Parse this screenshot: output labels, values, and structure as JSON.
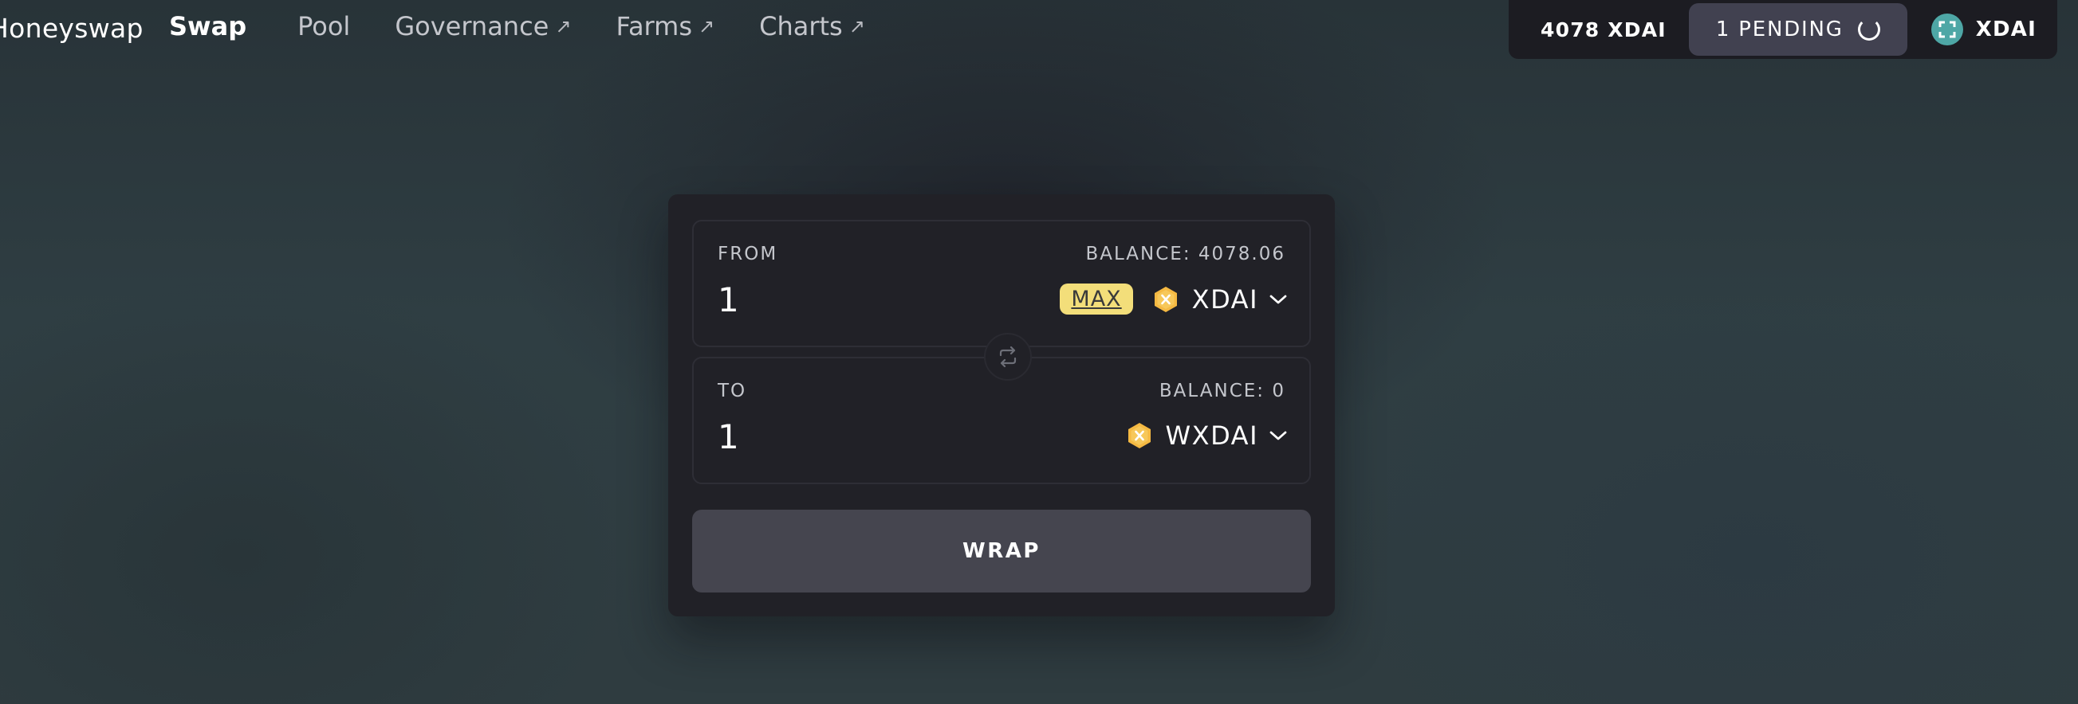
{
  "app": {
    "logo_text": "Honeyswap"
  },
  "nav": {
    "items": [
      {
        "label": "Swap",
        "active": true,
        "external": false
      },
      {
        "label": "Pool",
        "active": false,
        "external": false
      },
      {
        "label": "Governance",
        "active": false,
        "external": true
      },
      {
        "label": "Farms",
        "active": false,
        "external": true
      },
      {
        "label": "Charts",
        "active": false,
        "external": true
      }
    ],
    "external_glyph": "↗"
  },
  "account": {
    "balance": "4078 XDAI",
    "pending": "1 PENDING",
    "network": "XDAI",
    "network_icon": "xdai-network-icon",
    "network_color": "#4ea7a6"
  },
  "swap": {
    "from": {
      "label": "FROM",
      "balance": "BALANCE: 4078.06",
      "amount": "1",
      "max_label": "MAX",
      "token": "XDAI"
    },
    "to": {
      "label": "TO",
      "balance": "BALANCE: 0",
      "amount": "1",
      "token": "WXDAI"
    },
    "action_label": "WRAP",
    "switch_icon": "swap-arrows-icon"
  },
  "colors": {
    "max_bg": "#f3de7a",
    "token_icon": "#f5b942",
    "button_bg": "#45454f",
    "card_bg": "#212127"
  }
}
